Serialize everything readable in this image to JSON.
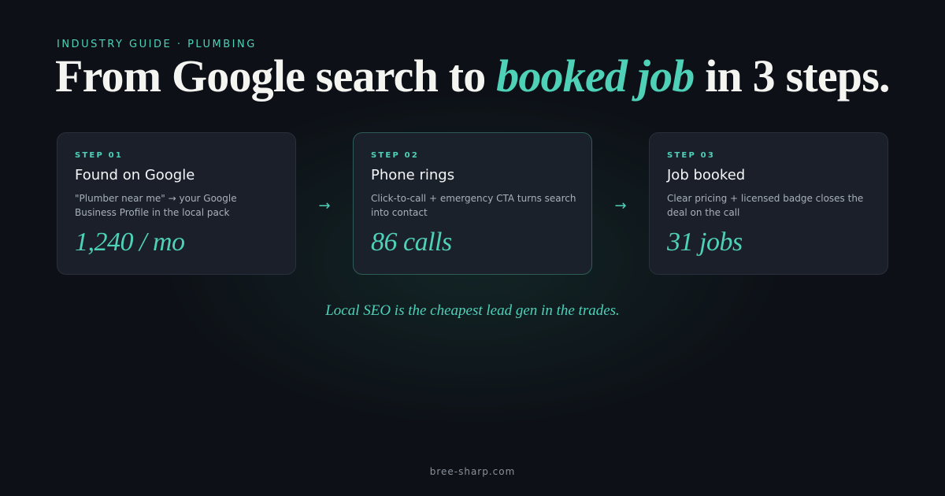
{
  "eyebrow": "INDUSTRY GUIDE · PLUMBING",
  "headline": {
    "before": "From Google search to ",
    "accent": "booked job",
    "after": " in 3 steps."
  },
  "steps": [
    {
      "label": "STEP 01",
      "title": "Found on Google",
      "description": "\"Plumber near me\" → your Google Business Profile in the local pack",
      "metric": "1,240 / mo"
    },
    {
      "label": "STEP 02",
      "title": "Phone rings",
      "description": "Click-to-call + emergency CTA turns search into contact",
      "metric": "86 calls"
    },
    {
      "label": "STEP 03",
      "title": "Job booked",
      "description": "Clear pricing + licensed badge closes the deal on the call",
      "metric": "31 jobs"
    }
  ],
  "arrows": [
    "→",
    "→"
  ],
  "tagline": "Local SEO is the cheapest lead gen in the trades.",
  "footer": "bree-sharp.com",
  "colors": {
    "background": "#0d1117",
    "accent": "#4fd1b8",
    "card": "#1a1f2a"
  }
}
